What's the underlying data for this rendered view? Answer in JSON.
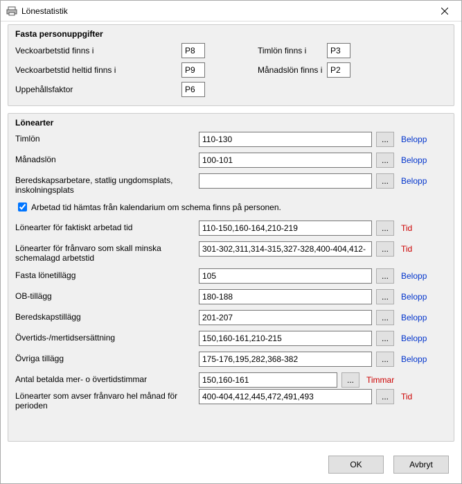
{
  "window": {
    "title": "Lönestatistik"
  },
  "fasta": {
    "legend": "Fasta personuppgifter",
    "veckoarbetstid_label": "Veckoarbetstid finns i",
    "veckoarbetstid_value": "P8",
    "timlon_label": "Timlön finns i",
    "timlon_value": "P3",
    "veckoarbetstid_heltid_label": "Veckoarbetstid heltid finns i",
    "veckoarbetstid_heltid_value": "P9",
    "manadslon_label": "Månadslön finns i",
    "manadslon_value": "P2",
    "uppehallsfaktor_label": "Uppehållsfaktor",
    "uppehallsfaktor_value": "P6"
  },
  "lonearter": {
    "legend": "Lönearter",
    "timlon_label": "Timlön",
    "timlon_value": "110-130",
    "manadslon_label": "Månadslön",
    "manadslon_value": "100-101",
    "beredskap_label": "Beredskapsarbetare, statlig ungdomsplats, inskolningsplats",
    "beredskap_value": "",
    "checkbox_label": "Arbetad tid hämtas från kalendarium om schema finns på personen.",
    "faktiskt_label": "Lönearter för faktiskt arbetad tid",
    "faktiskt_value": "110-150,160-164,210-219",
    "franvaro_label": "Lönearter för frånvaro som skall minska schemalagd arbetstid",
    "franvaro_value": "301-302,311,314-315,327-328,400-404,412-",
    "fasta_tillagg_label": "Fasta lönetillägg",
    "fasta_tillagg_value": "105",
    "ob_label": "OB-tillägg",
    "ob_value": "180-188",
    "beredskapstillagg_label": "Beredskapstillägg",
    "beredskapstillagg_value": "201-207",
    "overtid_label": "Övertids-/mertidsersättning",
    "overtid_value": "150,160-161,210-215",
    "ovriga_label": "Övriga tillägg",
    "ovriga_value": "175-176,195,282,368-382",
    "antal_label": "Antal betalda mer- o övertidstimmar",
    "antal_value": "150,160-161",
    "franvaro_hel_label": "Lönearter som avser frånvaro hel månad för perioden",
    "franvaro_hel_value": "400-404,412,445,472,491,493"
  },
  "tags": {
    "belopp": "Belopp",
    "tid": "Tid",
    "timmar": "Timmar"
  },
  "buttons": {
    "ellipsis": "...",
    "ok": "OK",
    "avbryt": "Avbryt"
  }
}
